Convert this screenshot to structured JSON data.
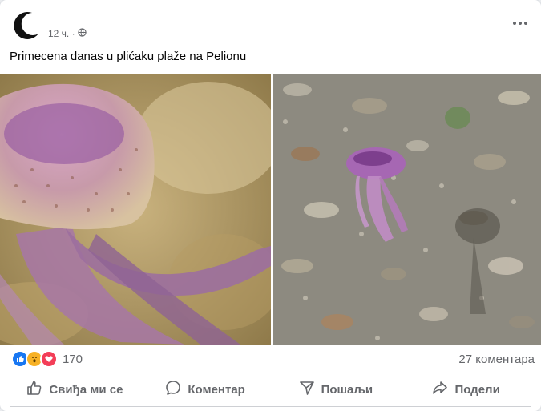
{
  "post": {
    "author": "",
    "time": "12 ч. ·",
    "caption": "Primecena danas u plićaku plaže na Pelionu",
    "privacy_icon": "globe-icon",
    "more_icon": "more-horizontal-icon"
  },
  "reactions": {
    "icons": [
      "like-icon",
      "wow-icon",
      "love-icon"
    ],
    "count": "170",
    "comments": "27 коментара"
  },
  "actions": [
    {
      "label": "Свиђа ми се",
      "icon": "thumbs-up-icon"
    },
    {
      "label": "Коментар",
      "icon": "comment-icon"
    },
    {
      "label": "Пошаљи",
      "icon": "send-icon"
    },
    {
      "label": "Подели",
      "icon": "share-icon"
    }
  ],
  "colors": {
    "text_primary": "#050505",
    "text_secondary": "#65676b",
    "like_blue": "#1877f2",
    "love_red": "#f33e58",
    "wow_yellow": "#f7b125"
  }
}
